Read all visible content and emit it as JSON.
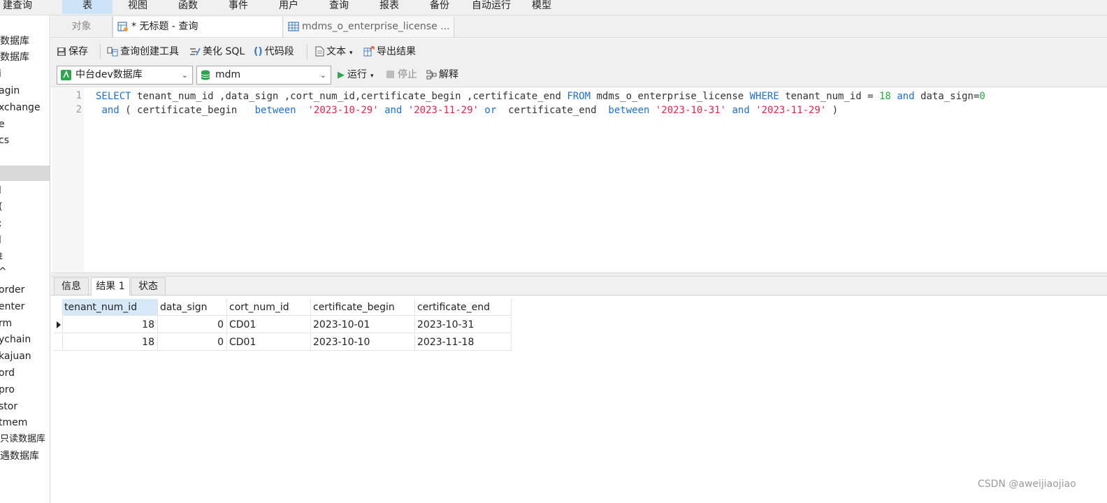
{
  "menubar": {
    "items": [
      "建查询",
      "表",
      "视图",
      "函数",
      "事件",
      "用户",
      "查询",
      "报表",
      "备份",
      "自动运行",
      "模型"
    ],
    "active": "表"
  },
  "sidebar": {
    "items": [
      "数据库",
      "数据库",
      "i",
      "agin",
      "xchange",
      "e",
      "cs",
      "",
      "l",
      "(",
      ":",
      "l",
      "ŧ",
      "^",
      "order",
      "enter",
      "rm",
      "ychain",
      "kajuan",
      "ord",
      "pro",
      "stor",
      "tmem",
      "只读数据库",
      "遇数据库"
    ],
    "selected_index": 7
  },
  "tabs": {
    "objects": "对象",
    "query": "* 无标题 - 查询",
    "table": "mdms_o_enterprise_license ..."
  },
  "toolbar": {
    "save": "保存",
    "query_builder": "查询创建工具",
    "beautify": "美化 SQL",
    "snippet": "代码段",
    "text": "文本",
    "export": "导出结果"
  },
  "connection": {
    "connection_value": "中台dev数据库",
    "database_value": "mdm",
    "run": "运行",
    "stop": "停止",
    "explain": "解释"
  },
  "editor": {
    "line_numbers": [
      "1",
      "2"
    ],
    "line1": {
      "k1": "SELECT",
      "t1": " tenant_num_id ,data_sign ,cort_num_id,certificate_begin ,certificate_end ",
      "k2": "FROM",
      "t2": " mdms_o_enterprise_license ",
      "k3": "WHERE",
      "t3": " tenant_num_id = ",
      "n1": "18",
      "t4": " ",
      "k4": "and",
      "t5": " data_sign=",
      "n2": "0"
    },
    "line2": {
      "t0": " ",
      "k1": "and",
      "t1": " ( certificate_begin   ",
      "k2": "between",
      "t2": "  ",
      "s1": "'2023-10-29'",
      "t3": " ",
      "k3": "and",
      "t4": " ",
      "s2": "'2023-11-29'",
      "t5": " ",
      "k4": "or",
      "t6": "  certificate_end  ",
      "k5": "between",
      "t7": " ",
      "s3": "'2023-10-31'",
      "t8": " ",
      "k6": "and",
      "t9": " ",
      "s4": "'2023-11-29'",
      "t10": " )"
    }
  },
  "result_tabs": [
    "信息",
    "结果 1",
    "状态"
  ],
  "result_active": "结果 1",
  "results": {
    "columns": [
      "tenant_num_id",
      "data_sign",
      "cort_num_id",
      "certificate_begin",
      "certificate_end"
    ],
    "rows": [
      [
        "18",
        "0",
        "CD01",
        "2023-10-01",
        "2023-10-31"
      ],
      [
        "18",
        "0",
        "CD01",
        "2023-10-10",
        "2023-11-18"
      ]
    ]
  },
  "watermark": "CSDN @aweijiaojiao",
  "colors": {
    "keyword": "#1a6fd8",
    "string": "#e0264a",
    "number": "#1fae3d",
    "active_tab": "#cde3f7"
  }
}
